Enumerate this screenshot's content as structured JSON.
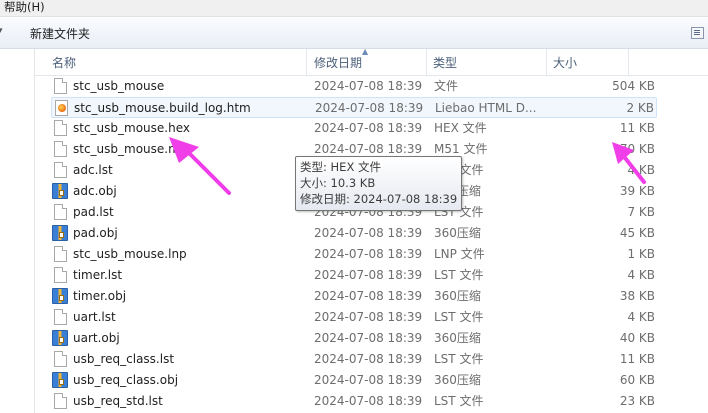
{
  "menu": {
    "help": "帮助(H)"
  },
  "toolbar": {
    "new_folder": "新建文件夹"
  },
  "columns": {
    "name": "名称",
    "date": "修改日期",
    "type": "类型",
    "size": "大小"
  },
  "files": [
    {
      "name": "stc_usb_mouse",
      "date": "2024-07-08 18:39",
      "type": "文件",
      "size": "504 KB",
      "icon": "file-icon"
    },
    {
      "name": "stc_usb_mouse.build_log.htm",
      "date": "2024-07-08 18:39",
      "type": "Liebao HTML D...",
      "size": "2 KB",
      "icon": "html-file-icon"
    },
    {
      "name": "stc_usb_mouse.hex",
      "date": "2024-07-08 18:39",
      "type": "HEX 文件",
      "size": "11 KB",
      "icon": "file-icon"
    },
    {
      "name": "stc_usb_mouse.m5",
      "date": "2024-07-08 18:39",
      "type": "M51 文件",
      "size": "70 KB",
      "icon": "file-icon"
    },
    {
      "name": "adc.lst",
      "date": "2024-07-08 18:39",
      "type": "LST 文件",
      "size": "4 KB",
      "icon": "file-icon"
    },
    {
      "name": "adc.obj",
      "date": "2024-07-08 18:39",
      "type": "360压缩",
      "size": "39 KB",
      "icon": "archive-icon"
    },
    {
      "name": "pad.lst",
      "date": "2024-07-08 18:39",
      "type": "LST 文件",
      "size": "7 KB",
      "icon": "file-icon"
    },
    {
      "name": "pad.obj",
      "date": "2024-07-08 18:39",
      "type": "360压缩",
      "size": "45 KB",
      "icon": "archive-icon"
    },
    {
      "name": "stc_usb_mouse.lnp",
      "date": "2024-07-08 18:39",
      "type": "LNP 文件",
      "size": "1 KB",
      "icon": "file-icon"
    },
    {
      "name": "timer.lst",
      "date": "2024-07-08 18:39",
      "type": "LST 文件",
      "size": "4 KB",
      "icon": "file-icon"
    },
    {
      "name": "timer.obj",
      "date": "2024-07-08 18:39",
      "type": "360压缩",
      "size": "38 KB",
      "icon": "archive-icon"
    },
    {
      "name": "uart.lst",
      "date": "2024-07-08 18:39",
      "type": "LST 文件",
      "size": "4 KB",
      "icon": "file-icon"
    },
    {
      "name": "uart.obj",
      "date": "2024-07-08 18:39",
      "type": "360压缩",
      "size": "40 KB",
      "icon": "archive-icon"
    },
    {
      "name": "usb_req_class.lst",
      "date": "2024-07-08 18:39",
      "type": "LST 文件",
      "size": "11 KB",
      "icon": "file-icon"
    },
    {
      "name": "usb_req_class.obj",
      "date": "2024-07-08 18:39",
      "type": "360压缩",
      "size": "60 KB",
      "icon": "archive-icon"
    },
    {
      "name": "usb_req_std.lst",
      "date": "2024-07-08 18:39",
      "type": "LST 文件",
      "size": "23 KB",
      "icon": "file-icon"
    }
  ],
  "tooltip": {
    "type_line": "类型: HEX 文件",
    "size_line": "大小: 10.3 KB",
    "date_line": "修改日期: 2024-07-08 18:39"
  },
  "colors": {
    "annotation_arrow": "#f03ee8",
    "hover_row": "#f2f7fd",
    "header_text": "#4c607a"
  }
}
